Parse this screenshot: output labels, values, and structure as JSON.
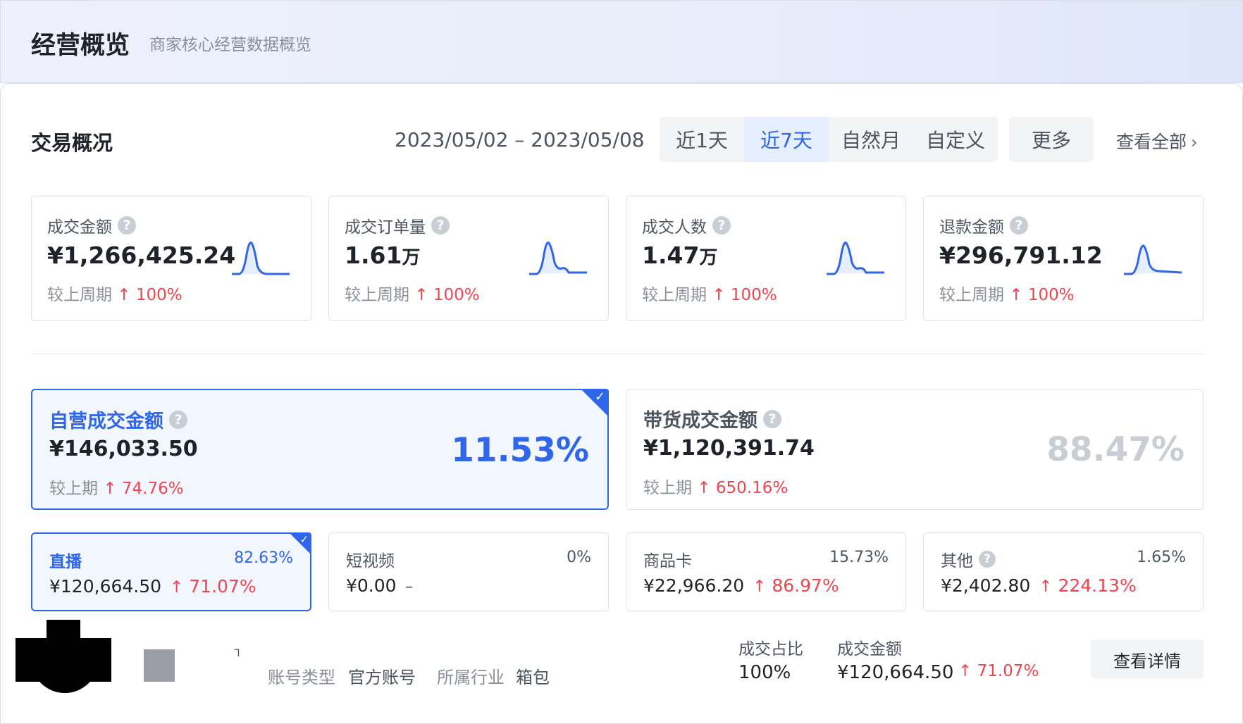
{
  "header": {
    "title": "经营概览",
    "subtitle": "商家核心经营数据概览"
  },
  "transaction": {
    "section_title": "交易概况",
    "date_range": "2023/05/02 – 2023/05/08",
    "range_tabs": [
      {
        "label": "近1天",
        "active": false
      },
      {
        "label": "近7天",
        "active": true
      },
      {
        "label": "自然月",
        "active": false
      },
      {
        "label": "自定义",
        "active": false
      }
    ],
    "more_label": "更多",
    "view_all_label": "查看全部",
    "compare_prefix": "较上周期",
    "metrics": [
      {
        "label": "成交金额",
        "value": "¥1,266,425.24",
        "unit": "",
        "change": "100%"
      },
      {
        "label": "成交订单量",
        "value": "1.61",
        "unit": "万",
        "change": "100%"
      },
      {
        "label": "成交人数",
        "value": "1.47",
        "unit": "万",
        "change": "100%"
      },
      {
        "label": "退款金额",
        "value": "¥296,791.12",
        "unit": "",
        "change": "100%"
      }
    ]
  },
  "channels": {
    "compare_prefix": "较上期",
    "big": [
      {
        "label": "自营成交金额",
        "value": "¥146,033.50",
        "change": "74.76%",
        "share": "11.53%",
        "selected": true
      },
      {
        "label": "带货成交金额",
        "value": "¥1,120,391.74",
        "change": "650.16%",
        "share": "88.47%",
        "selected": false
      }
    ],
    "small": [
      {
        "label": "直播",
        "share": "82.63%",
        "value": "¥120,664.50",
        "change": "71.07%",
        "selected": true
      },
      {
        "label": "短视频",
        "share": "0%",
        "value": "¥0.00",
        "change": "–",
        "selected": false
      },
      {
        "label": "商品卡",
        "share": "15.73%",
        "value": "¥22,966.20",
        "change": "86.97%",
        "selected": false
      },
      {
        "label": "其他",
        "share": "1.65%",
        "value": "¥2,402.80",
        "change": "224.13%",
        "selected": false
      }
    ]
  },
  "account": {
    "type_label": "账号类型",
    "type_value": "官方账号",
    "industry_label": "所属行业",
    "industry_value": "箱包",
    "ratio_label": "成交占比",
    "ratio_value": "100%",
    "amount_label": "成交金额",
    "amount_value": "¥120,664.50",
    "amount_change": "71.07%",
    "detail_button": "查看详情"
  },
  "icons": {
    "help": "question-circle-icon",
    "up_arrow": "arrow-up-icon",
    "chevron": "chevron-right-icon",
    "check": "check-corner-icon"
  },
  "colors": {
    "accent": "#2f66ea",
    "up": "#f0454f",
    "muted": "#c9cdd4"
  }
}
